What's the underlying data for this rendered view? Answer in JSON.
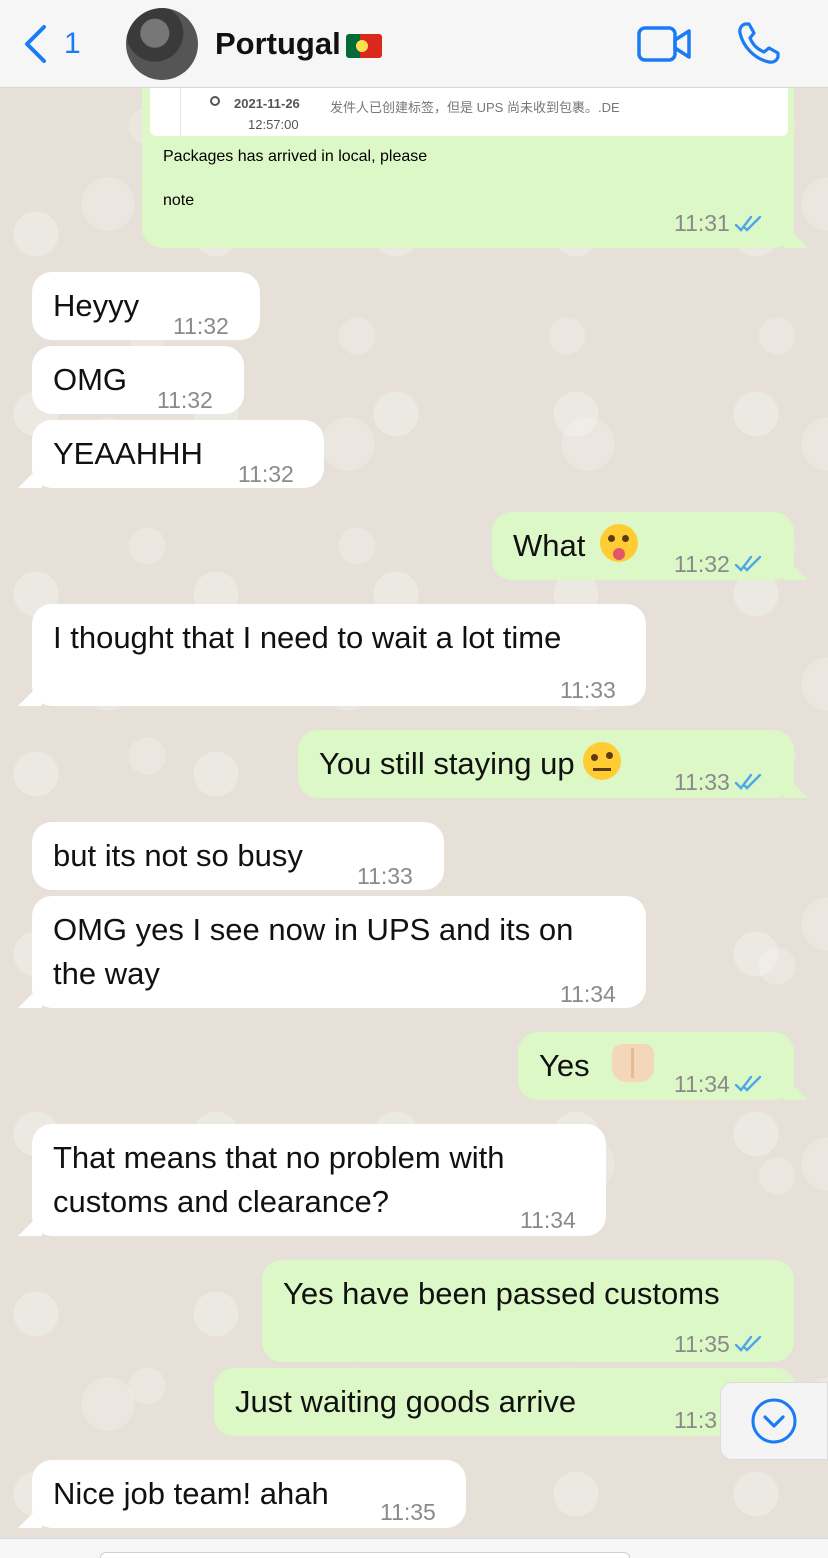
{
  "header": {
    "back_count": "1",
    "contact_name": "Portugal",
    "flag": "portugal-flag"
  },
  "tracking": {
    "date": "2021-11-26",
    "time": "12:57:00",
    "description": "发件人已创建标签，但是 UPS 尚未收到包裹。.DE"
  },
  "messages": [
    {
      "dir": "out",
      "text": "Packages has arrived in local, please",
      "text2": "note",
      "time": "11:31"
    },
    {
      "dir": "in",
      "text": "Heyyy",
      "time": "11:32"
    },
    {
      "dir": "in",
      "text": "OMG",
      "time": "11:32"
    },
    {
      "dir": "in",
      "text": "YEAAHHH",
      "time": "11:32"
    },
    {
      "dir": "out",
      "text": "What",
      "emoji": "winking-face-with-tongue",
      "time": "11:32"
    },
    {
      "dir": "in",
      "text": "I thought that I need to wait a lot time",
      "time": "11:33"
    },
    {
      "dir": "out",
      "text": "You still staying up",
      "emoji": "face-with-raised-eyebrow",
      "time": "11:33"
    },
    {
      "dir": "in",
      "text": "but its not so busy",
      "time": "11:33"
    },
    {
      "dir": "in",
      "text": "OMG yes I see now in UPS and its on",
      "text2": "the way",
      "time": "11:34"
    },
    {
      "dir": "out",
      "text": "Yes",
      "emoji": "raising-hands",
      "time": "11:34"
    },
    {
      "dir": "in",
      "text": "That means that no problem with",
      "text2": "customs and clearance?",
      "time": "11:34"
    },
    {
      "dir": "out",
      "text": "Yes have been passed customs",
      "time": "11:35"
    },
    {
      "dir": "out",
      "text": "Just waiting goods arrive",
      "time": "11:3"
    },
    {
      "dir": "in",
      "text": "Nice job team! ahah",
      "time": "11:35"
    }
  ],
  "colors": {
    "accent": "#1a7cf5",
    "outgoing_bubble": "#dcf8c6",
    "incoming_bubble": "#ffffff",
    "read_ticks": "#4fa6e8"
  }
}
